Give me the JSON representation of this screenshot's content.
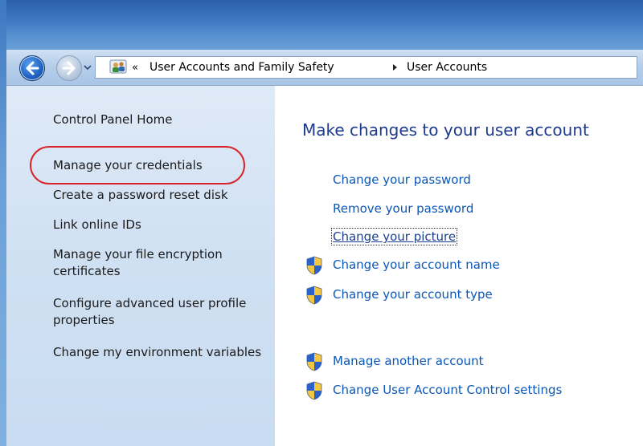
{
  "breadcrumb": {
    "overflow_chevron": "«",
    "items": [
      "User Accounts and Family Safety",
      "User Accounts"
    ]
  },
  "sidebar": {
    "items": [
      "Control Panel Home",
      "Manage your credentials",
      "Create a password reset disk",
      "Link online IDs",
      "Manage your file encryption certificates",
      "Configure advanced user profile properties",
      "Change my environment variables"
    ]
  },
  "main": {
    "title": "Make changes to your user account",
    "tasks": [
      {
        "label": "Change your password",
        "icon": "none"
      },
      {
        "label": "Remove your password",
        "icon": "none"
      },
      {
        "label": "Change your picture",
        "icon": "none"
      },
      {
        "label": "Change your account name",
        "icon": "uac-shield-icon"
      },
      {
        "label": "Change your account type",
        "icon": "uac-shield-icon"
      }
    ],
    "other_tasks": [
      {
        "label": "Manage another account",
        "icon": "uac-shield-icon"
      },
      {
        "label": "Change User Account Control settings",
        "icon": "uac-shield-icon"
      }
    ]
  },
  "colors": {
    "link": "#0b57b8",
    "title": "#1e3a8c",
    "highlight": "#d9252a"
  }
}
